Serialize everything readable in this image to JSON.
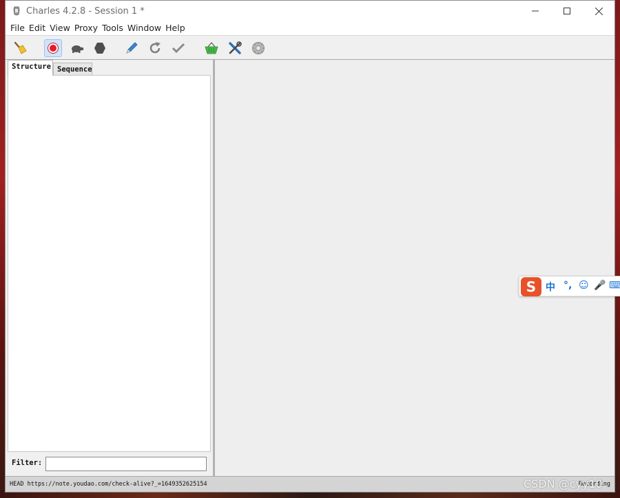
{
  "window": {
    "title": "Charles 4.2.8 - Session 1 *"
  },
  "menu": {
    "items": [
      "File",
      "Edit",
      "View",
      "Proxy",
      "Tools",
      "Window",
      "Help"
    ]
  },
  "toolbar": {
    "buttons": [
      {
        "name": "broom-icon",
        "active": false
      },
      {
        "name": "record-icon",
        "active": true
      },
      {
        "name": "turtle-throttle-icon",
        "active": false
      },
      {
        "name": "stop-hexagon-icon",
        "active": false
      },
      {
        "name": "pen-compose-icon",
        "active": false
      },
      {
        "name": "repeat-refresh-icon",
        "active": false
      },
      {
        "name": "validate-check-icon",
        "active": false
      },
      {
        "name": "basket-icon",
        "active": false
      },
      {
        "name": "tools-icon",
        "active": false
      },
      {
        "name": "settings-gear-icon",
        "active": false
      }
    ]
  },
  "left_panel": {
    "tabs": [
      "Structure",
      "Sequence"
    ],
    "selected_tab": "Structure",
    "filter_label": "Filter:",
    "filter_value": ""
  },
  "status": {
    "text": "HEAD https://note.youdao.com/check-alive?_=1649352625154",
    "right": "Recording"
  },
  "ime": {
    "logo": "S",
    "items": [
      "中",
      "°,",
      "☺",
      "🎤",
      "⌨"
    ]
  },
  "watermark": "CSDN @cyy10",
  "colors": {
    "record_red": "#e8192c",
    "active_button": "#cfe4fb",
    "ime_orange": "#e8522a",
    "ime_blue": "#1a73d8"
  }
}
